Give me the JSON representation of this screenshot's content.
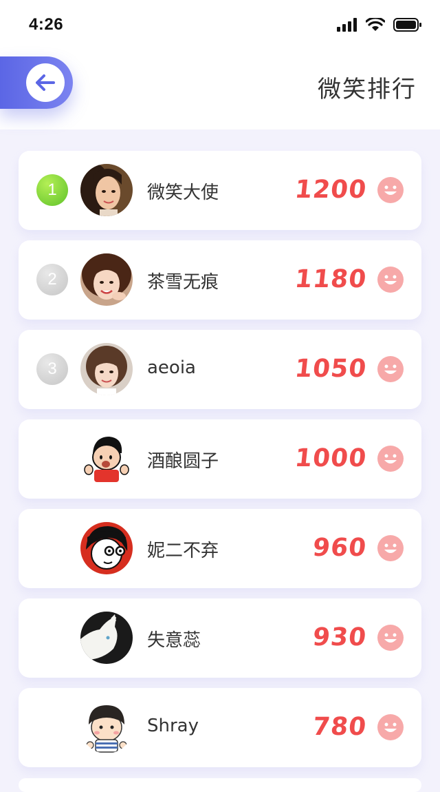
{
  "status_bar": {
    "time": "4:26"
  },
  "header": {
    "title": "微笑排行"
  },
  "ranking": [
    {
      "rank": "1",
      "name": "微笑大使",
      "score": "1200",
      "avatar": "photo-woman-1"
    },
    {
      "rank": "2",
      "name": "茶雪无痕",
      "score": "1180",
      "avatar": "photo-woman-2"
    },
    {
      "rank": "3",
      "name": "aeoia",
      "score": "1050",
      "avatar": "photo-woman-3"
    },
    {
      "rank": "",
      "name": "酒酿圆子",
      "score": "1000",
      "avatar": "cartoon-boy-red"
    },
    {
      "rank": "",
      "name": "妮二不弃",
      "score": "960",
      "avatar": "cartoon-girl-bw"
    },
    {
      "rank": "",
      "name": "失意蕊",
      "score": "930",
      "avatar": "white-cat"
    },
    {
      "rank": "",
      "name": "Shray",
      "score": "780",
      "avatar": "cartoon-boy-stripes"
    }
  ],
  "colors": {
    "accent": "#5b66e5",
    "score": "#f04c4c",
    "smile_icon": "#f7a9a9",
    "rank_gold": "#5fc22a",
    "rank_silver": "#c6c6c6",
    "background": "#f3f2fc"
  },
  "icons": {
    "back": "arrow-left-icon",
    "smile": "smile-face-icon",
    "signal": "signal-icon",
    "wifi": "wifi-icon",
    "battery": "battery-icon"
  }
}
